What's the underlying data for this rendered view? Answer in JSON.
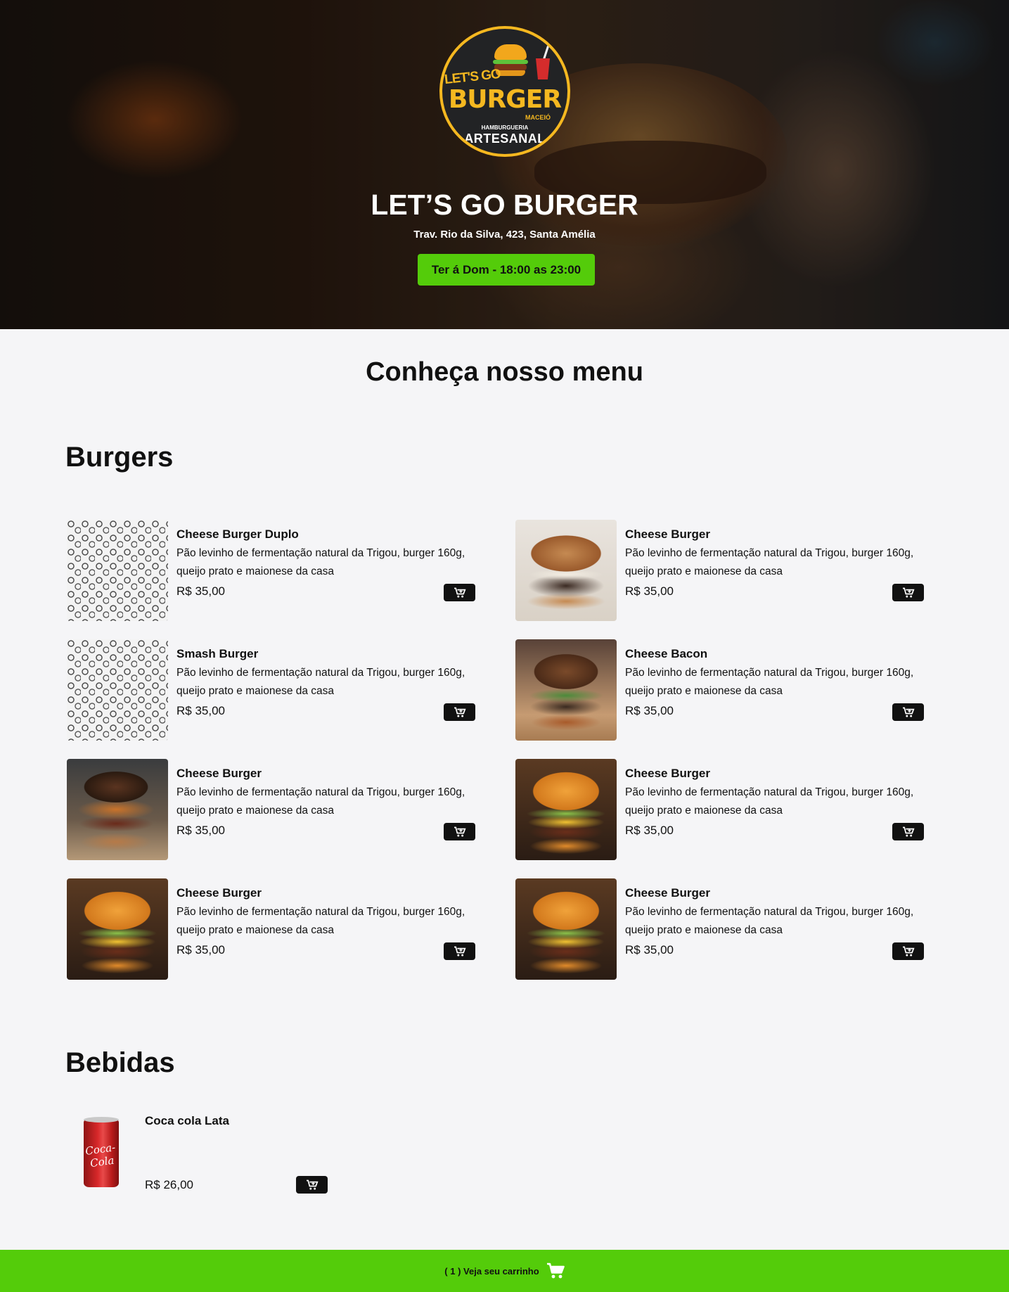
{
  "hero": {
    "logo": {
      "lets_go": "LET'S GO",
      "burger": "BURGER",
      "city": "MACEIÓ",
      "hamburgueria": "HAMBURGUERIA",
      "artesanal": "ARTESANAL"
    },
    "title": "LET’S GO BURGER",
    "address": "Trav. Rio da Silva, 423, Santa Amélia",
    "hours": "Ter á Dom - 18:00 as 23:00"
  },
  "menu": {
    "title": "Conheça nosso menu",
    "sections": [
      {
        "title": "Burgers",
        "items": [
          {
            "name": "Cheese Burger Duplo",
            "description": "Pão levinho de fermentação natural da Trigou, burger 160g, queijo prato e maionese da casa",
            "price": "R$ 35,00",
            "image": "burger-pattern"
          },
          {
            "name": "Cheese Burger",
            "description": "Pão levinho de fermentação natural da Trigou, burger 160g, queijo prato e maionese da casa",
            "price": "R$ 35,00",
            "image": "burger-photo"
          },
          {
            "name": "Smash Burger",
            "description": "Pão levinho de fermentação natural da Trigou, burger 160g, queijo prato e maionese da casa",
            "price": "R$ 35,00",
            "image": "burger-pattern"
          },
          {
            "name": "Cheese Bacon",
            "description": "Pão levinho de fermentação natural da Trigou, burger 160g, queijo prato e maionese da casa",
            "price": "R$ 35,00",
            "image": "burger-photo"
          },
          {
            "name": "Cheese Burger",
            "description": "Pão levinho de fermentação natural da Trigou, burger 160g, queijo prato e maionese da casa",
            "price": "R$ 35,00",
            "image": "burger-photo"
          },
          {
            "name": "Cheese Burger",
            "description": "Pão levinho de fermentação natural da Trigou, burger 160g, queijo prato e maionese da casa",
            "price": "R$ 35,00",
            "image": "burger-photo"
          },
          {
            "name": "Cheese Burger",
            "description": "Pão levinho de fermentação natural da Trigou, burger 160g, queijo prato e maionese da casa",
            "price": "R$ 35,00",
            "image": "burger-photo"
          },
          {
            "name": "Cheese Burger",
            "description": "Pão levinho de fermentação natural da Trigou, burger 160g, queijo prato e maionese da casa",
            "price": "R$ 35,00",
            "image": "burger-photo"
          }
        ]
      },
      {
        "title": "Bebidas",
        "items": [
          {
            "name": "Coca cola Lata",
            "price": "R$ 26,00",
            "image": "coca-cola-can",
            "can_logo": "Coca-Cola"
          }
        ]
      }
    ]
  },
  "cart": {
    "label": "( 1 ) Veja seu carrinho",
    "icon": "cart-icon"
  },
  "colors": {
    "accent_green": "#54cc0a",
    "button_dark": "#111111",
    "background": "#f5f5f7",
    "logo_yellow": "#f5b820"
  }
}
